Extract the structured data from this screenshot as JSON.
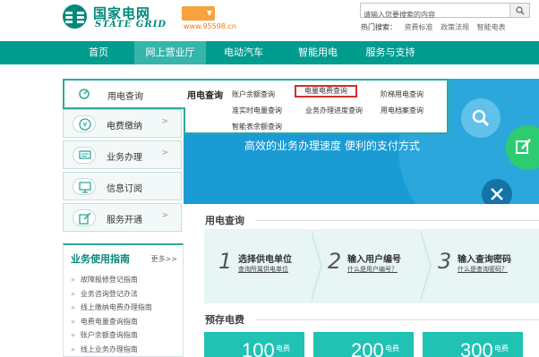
{
  "header": {
    "logo_cn": "国家电网",
    "logo_en": "STATE GRID",
    "region_arrow": "▼",
    "hotline": "www.95598.cn",
    "search_placeholder": "请输入您要搜索的内容",
    "hot_title": "热门搜索：",
    "hot_words": [
      "资费标准",
      "政策法规",
      "智能电表"
    ]
  },
  "nav": {
    "items": [
      "首页",
      "网上营业厅",
      "电动汽车",
      "智能用电",
      "服务与支持"
    ],
    "active_index": 1
  },
  "left_menu": {
    "items": [
      {
        "label": "用电查询",
        "icon": "search-gauge-icon"
      },
      {
        "label": "电费缴纳",
        "icon": "coin-icon"
      },
      {
        "label": "业务办理",
        "icon": "chat-icon"
      },
      {
        "label": "信息订阅",
        "icon": "monitor-icon"
      },
      {
        "label": "服务开通",
        "icon": "edit-icon"
      }
    ],
    "arrow": ">"
  },
  "dropdown": {
    "title": "用电查询",
    "links": [
      "账户余额查询",
      "电量电费查询",
      "阶梯用电查询",
      "准实时电量查询",
      "业务办理进度查询",
      "用电档案查询",
      "智能表余额查询"
    ]
  },
  "banner": {
    "text": "高效的业务办理速度  便利的支付方式"
  },
  "guide": {
    "title": "业务使用指南",
    "more": "更多>>",
    "items": [
      "故障报修登记指南",
      "业务咨询登记办法",
      "线上缴纳电费办理指南",
      "电费电量查询指南",
      "账户余额查询指南",
      "线上业务办理指南"
    ]
  },
  "query_section": {
    "title": "用电查询",
    "steps": [
      {
        "num": "1",
        "main": "选择供电单位",
        "sub": "查询所属供电单位"
      },
      {
        "num": "2",
        "main": "输入用户编号",
        "sub": "什么是用户编号？"
      },
      {
        "num": "3",
        "main": "输入查询密码",
        "sub": "什么是查询密码？"
      }
    ]
  },
  "prepaid_section": {
    "title": "预存电费",
    "tiles": [
      {
        "amount": "100",
        "unit": "电费"
      },
      {
        "amount": "200",
        "unit": "电费"
      },
      {
        "amount": "300",
        "unit": "电费"
      }
    ]
  },
  "colors": {
    "brand": "#009d8f",
    "accent": "#2ea89b",
    "banner": "#1a9bd4",
    "tile": "#20c2b4",
    "highlight": "#d32f2f"
  }
}
